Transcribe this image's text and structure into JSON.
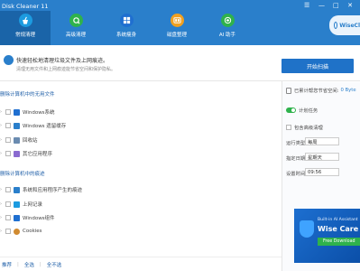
{
  "app": {
    "title": "Disk Cleaner 11"
  },
  "window_controls": [
    "☰",
    "—",
    "□",
    "✕"
  ],
  "nav": [
    {
      "label": "常规清理",
      "icon": "broom-icon",
      "color": "#1c9be0"
    },
    {
      "label": "高级清理",
      "icon": "sweep-icon",
      "color": "#2fb24c"
    },
    {
      "label": "系统瘦身",
      "icon": "windows-icon",
      "color": "#1f6fd0"
    },
    {
      "label": "磁盘整理",
      "icon": "defrag-icon",
      "color": "#f0a020"
    },
    {
      "label": "AI 助手",
      "icon": "ai-icon",
      "color": "#2fb24c"
    }
  ],
  "brand": {
    "text": "WiseCl"
  },
  "notice": {
    "title": "快速轻松地清理垃圾文件及上网痕迹。",
    "subtitle": "清理无用文件和上网痕迹能节省空间和保护隐私。",
    "scan_button": "开始扫描"
  },
  "sections": [
    {
      "title": "删除计算机中的无用文件",
      "items": [
        {
          "label": "Windows系统",
          "icon": "windows-icon",
          "color": "#1f6fd0"
        },
        {
          "label": "Windows 遗留缓存",
          "icon": "cache-icon",
          "color": "#2a7fcb"
        },
        {
          "label": "回收站",
          "icon": "recycle-bin-icon",
          "color": "#6a8bb0"
        },
        {
          "label": "其它应用程序",
          "icon": "apps-icon",
          "color": "#8a6bd0"
        }
      ]
    },
    {
      "title": "删除计算机中的痕迹",
      "items": [
        {
          "label": "系统和应用程序产生的痕迹",
          "icon": "trace-icon",
          "color": "#2a7fcb"
        },
        {
          "label": "上网记录",
          "icon": "browser-icon",
          "color": "#1c9be0"
        },
        {
          "label": "Windows组件",
          "icon": "component-icon",
          "color": "#1f6fd0"
        },
        {
          "label": "Cookies",
          "icon": "cookie-icon",
          "color": "#d08a30"
        }
      ]
    }
  ],
  "footer": {
    "recommended": "推荐",
    "select_all": "全选",
    "select_none": "全不选"
  },
  "right_panel": {
    "saved_label": "已累计帮您节省空间:",
    "saved_value": "0 Byte",
    "schedule_label": "计划任务",
    "include_advanced": "包含高级清理",
    "run_type_label": "运行类型:",
    "run_type_value": "每周",
    "date_label": "指定日期:",
    "date_value": "星期天",
    "time_label": "设置时间:",
    "time_value": "09:56"
  },
  "ad": {
    "top": "Built-in AI Assistant",
    "main": "Wise Care 365",
    "button": "Free Download"
  },
  "colors": {
    "header": "#2a7fcb",
    "accent": "#1f72c8",
    "toggle_on": "#2fb24c"
  }
}
